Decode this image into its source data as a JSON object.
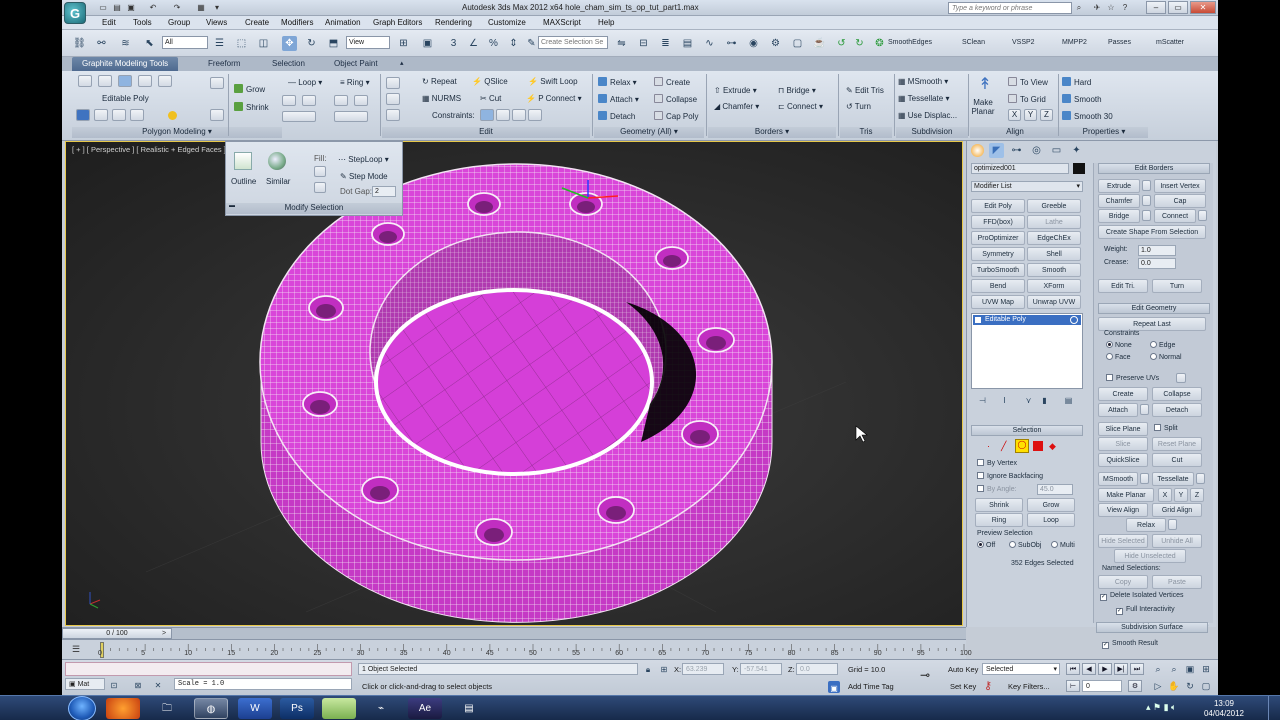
{
  "window": {
    "title": "Autodesk 3ds Max  2012 x64        hole_cham_sim_ts_op_tut_part1.max",
    "search_placeholder": "Type a keyword or phrase",
    "app_logo": "G"
  },
  "menu": [
    "Edit",
    "Tools",
    "Group",
    "Views",
    "Create",
    "Modifiers",
    "Animation",
    "Graph Editors",
    "Rendering",
    "Customize",
    "MAXScript",
    "Help"
  ],
  "main_toolbar": {
    "selection_filter": "All",
    "ref_coord": "View",
    "named_selection": "Create Selection Se",
    "labels": [
      "SmoothEdges",
      "SClean",
      "VSSP2",
      "MMPP2",
      "Passes",
      "mScatter"
    ]
  },
  "ribbon": {
    "tabs": [
      "Graphite Modeling Tools",
      "Freeform",
      "Selection",
      "Object Paint"
    ],
    "active_tab": "Graphite Modeling Tools",
    "polymodel": {
      "object_type": "Editable Poly",
      "grow": "Grow",
      "shrink": "Shrink",
      "loop": "Loop",
      "ring": "Ring"
    },
    "edit": {
      "repeat": "Repeat",
      "qslice": "QSlice",
      "swift_loop": "Swift Loop",
      "nurms": "NURMS",
      "cut": "Cut",
      "p_connect": "P Connect",
      "constraints": "Constraints:"
    },
    "geometry": {
      "relax": "Relax",
      "create": "Create",
      "attach": "Attach",
      "collapse": "Collapse",
      "detach": "Detach",
      "cap_poly": "Cap Poly"
    },
    "borders": {
      "extrude": "Extrude",
      "bridge": "Bridge",
      "chamfer": "Chamfer",
      "connect": "Connect"
    },
    "tris": {
      "edit_tris": "Edit Tris",
      "turn": "Turn"
    },
    "subdivision": {
      "msmooth": "MSmooth",
      "tessellate": "Tessellate",
      "use_displac": "Use Displac..."
    },
    "align": {
      "make_planar": "Make Planar",
      "to_view": "To View",
      "to_grid": "To Grid",
      "x": "X",
      "y": "Y",
      "z": "Z"
    },
    "properties": {
      "hard": "Hard",
      "smooth": "Smooth",
      "smooth30": "Smooth 30"
    },
    "group_labels": {
      "polygon_modeling": "Polygon Modeling",
      "edit": "Edit",
      "geometry": "Geometry (All)",
      "borders": "Borders",
      "tris": "Tris",
      "subdivision": "Subdivision",
      "align": "Align",
      "properties": "Properties"
    }
  },
  "flyout": {
    "outline": "Outline",
    "similar": "Similar",
    "fill": "Fill:",
    "step_loop": "StepLoop",
    "step_mode": "Step Mode",
    "dot_gap": "Dot Gap:",
    "dot_gap_value": "2",
    "title": "Modify Selection"
  },
  "viewport": {
    "label": "[ + ] [ Perspective ] [ Realistic + Edged Faces ]",
    "mesh_color": "#d946d9"
  },
  "command_panel": {
    "object_name": "optimized001",
    "modifier_list": "Modifier List",
    "modifier_buttons": [
      "Edit Poly",
      "Greeble",
      "FFD(box)",
      "Lathe",
      "ProOptimizer",
      "EdgeChEx",
      "Symmetry",
      "Shell",
      "TurboSmooth",
      "Smooth",
      "Bend",
      "XForm",
      "UVW Map",
      "Unwrap UVW"
    ],
    "stack_item": "Editable Poly",
    "selection": {
      "title": "Selection",
      "by_vertex": "By Vertex",
      "ignore_backfacing": "Ignore Backfacing",
      "by_angle": "By Angle:",
      "by_angle_value": "45.0",
      "shrink": "Shrink",
      "grow": "Grow",
      "ring": "Ring",
      "loop": "Loop",
      "preview": "Preview Selection",
      "off": "Off",
      "subobj": "SubObj",
      "multi": "Multi",
      "status": "352 Edges Selected"
    },
    "edit_borders": {
      "title": "Edit Borders",
      "extrude": "Extrude",
      "insert_vertex": "Insert Vertex",
      "chamfer": "Chamfer",
      "cap": "Cap",
      "bridge": "Bridge",
      "connect": "Connect",
      "create_shape": "Create Shape From Selection",
      "weight": "Weight:",
      "weight_value": "1.0",
      "crease": "Crease:",
      "crease_value": "0.0",
      "edit_tri": "Edit Tri.",
      "turn": "Turn"
    },
    "edit_geometry": {
      "title": "Edit Geometry",
      "repeat_last": "Repeat Last",
      "constraints": "Constraints",
      "none": "None",
      "edge": "Edge",
      "face": "Face",
      "normal": "Normal",
      "preserve_uvs": "Preserve UVs",
      "create": "Create",
      "collapse": "Collapse",
      "attach": "Attach",
      "detach": "Detach",
      "slice_plane": "Slice Plane",
      "split": "Split",
      "slice": "Slice",
      "reset_plane": "Reset Plane",
      "quickslice": "QuickSlice",
      "cut": "Cut",
      "msmooth": "MSmooth",
      "tessellate": "Tessellate",
      "make_planar": "Make Planar",
      "x": "X",
      "y": "Y",
      "z": "Z",
      "view_align": "View Align",
      "grid_align": "Grid Align",
      "relax": "Relax",
      "hide_selected": "Hide Selected",
      "unhide_all": "Unhide All",
      "hide_unselected": "Hide Unselected",
      "named_selections": "Named Selections:",
      "copy": "Copy",
      "paste": "Paste",
      "delete_isolated": "Delete Isolated Vertices",
      "full_interactivity": "Full Interactivity"
    },
    "subdivision_surface": {
      "title": "Subdivision Surface",
      "smooth_result": "Smooth Result"
    }
  },
  "timeline": {
    "frame": "0 / 100",
    "ticks": [
      "0",
      "5",
      "10",
      "15",
      "20",
      "25",
      "30",
      "35",
      "40",
      "45",
      "50",
      "55",
      "60",
      "65",
      "70",
      "75",
      "80",
      "85",
      "90",
      "95",
      "100"
    ]
  },
  "status": {
    "max_label": "Mat",
    "script_output": "Scale = 1.0",
    "objects_selected": "1 Object Selected",
    "prompt": "Click or click-and-drag to select objects",
    "x_label": "X:",
    "x_value": "63.239",
    "y_label": "Y:",
    "y_value": "-57.541",
    "z_label": "Z:",
    "z_value": "0.0",
    "grid": "Grid = 10.0",
    "add_time_tag": "Add Time Tag",
    "auto_key": "Auto Key",
    "auto_key_mode": "Selected",
    "set_key": "Set Key",
    "key_filters": "Key Filters...",
    "frame_value": "0"
  },
  "taskbar": {
    "apps": [
      "firefox",
      "explorer",
      "3ds-max",
      "word",
      "photoshop",
      "notepad",
      "usb",
      "after-effects",
      "other"
    ],
    "time": "13:09",
    "date": "04/04/2012"
  }
}
